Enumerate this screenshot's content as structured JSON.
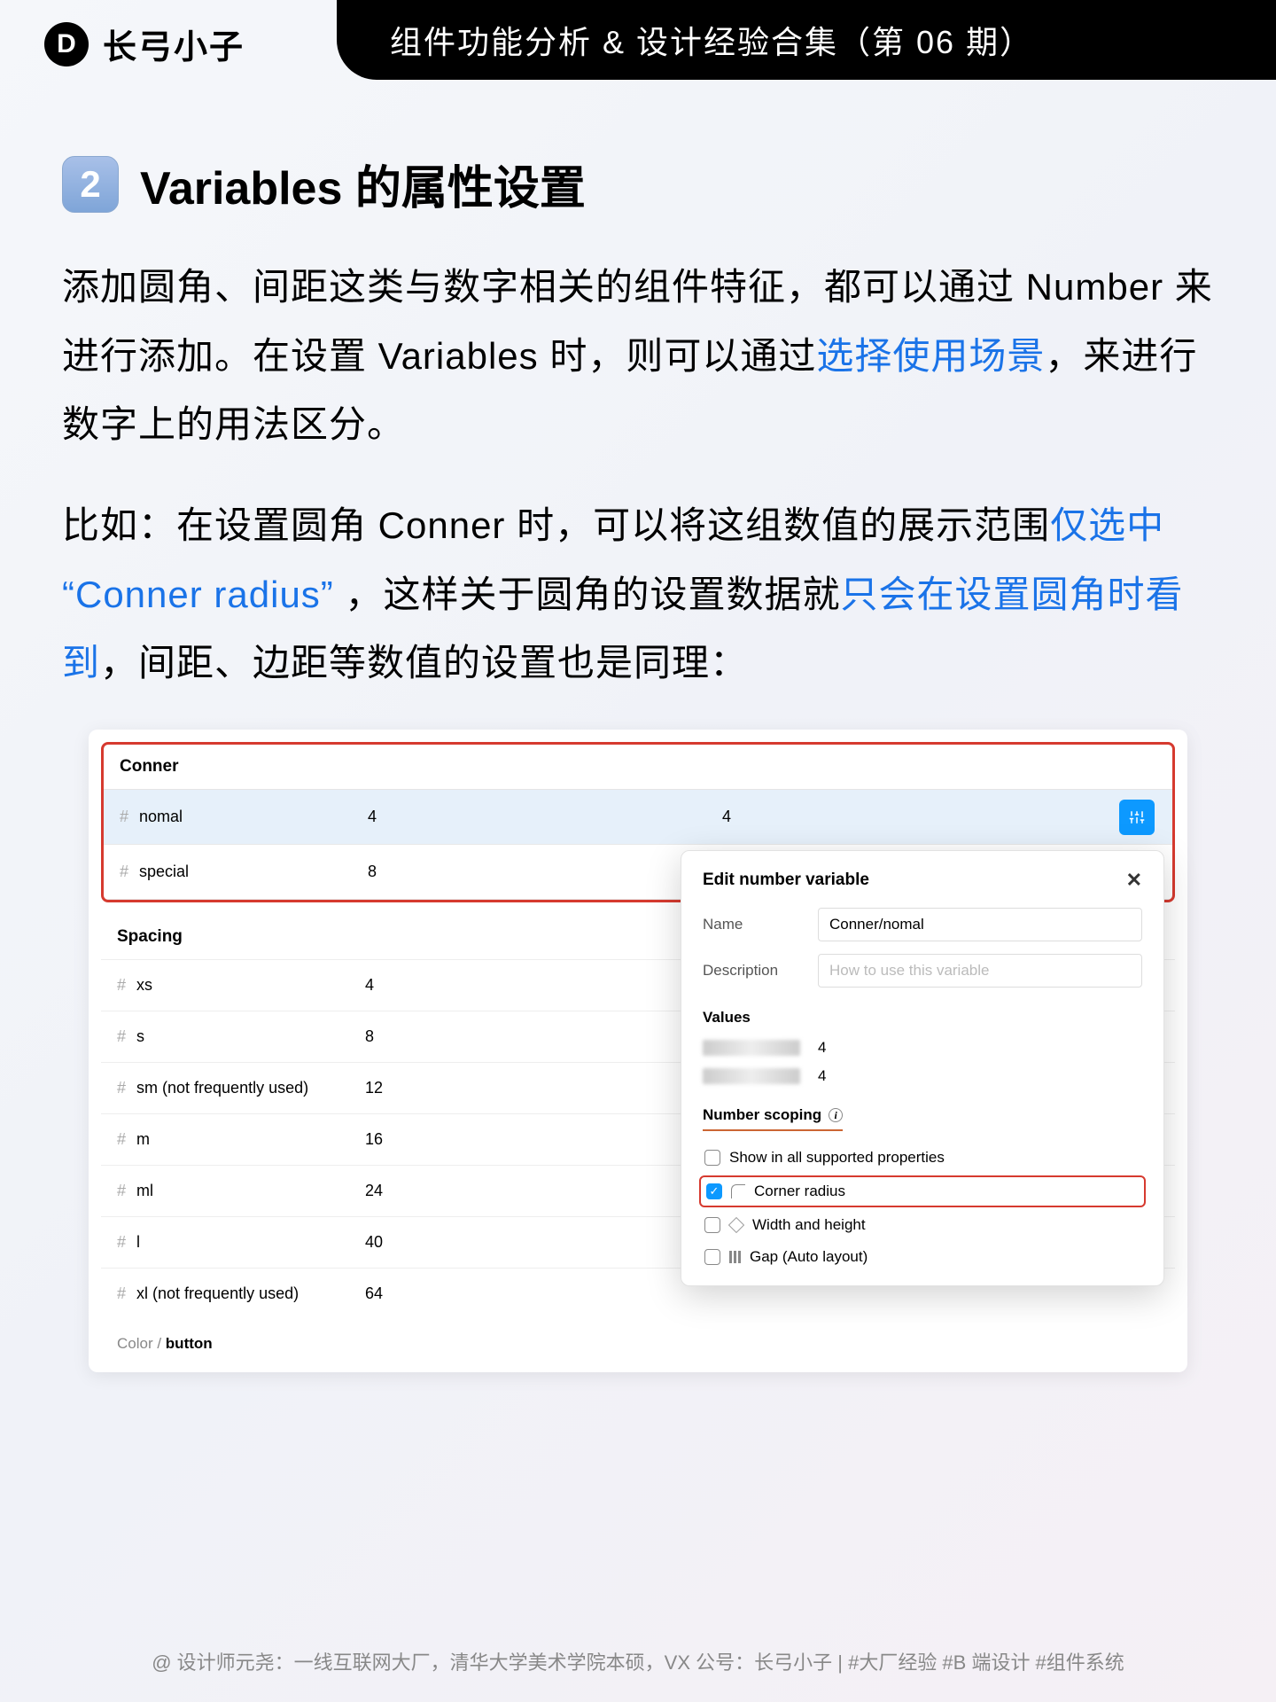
{
  "header": {
    "brand_logo": "D",
    "brand_name": "长弓小子",
    "title": "组件功能分析 & 设计经验合集（第 06 期）"
  },
  "section": {
    "badge": "2",
    "title": "Variables 的属性设置"
  },
  "paragraphs": {
    "p1a": "添加圆角、间距这类与数字相关的组件特征，都可以通过 Number 来进行添加。在设置 Variables 时，则可以通过",
    "p1b": "选择使用场景",
    "p1c": "，来进行数字上的用法区分。",
    "p2a": "比如：在设置圆角 Conner 时，可以将这组数值的展示范围",
    "p2b": "仅选中 “Conner radius” ",
    "p2c": "，这样关于圆角的设置数据就",
    "p2d": "只会在设置圆角时看到",
    "p2e": "，间距、边距等数值的设置也是同理："
  },
  "conner": {
    "label": "Conner",
    "rows": [
      {
        "name": "nomal",
        "v1": "4",
        "v2": "4"
      },
      {
        "name": "special",
        "v1": "8",
        "v2": ""
      }
    ]
  },
  "spacing": {
    "label": "Spacing",
    "rows": [
      {
        "name": "xs",
        "v": "4"
      },
      {
        "name": "s",
        "v": "8"
      },
      {
        "name": "sm (not frequently used)",
        "v": "12"
      },
      {
        "name": "m",
        "v": "16"
      },
      {
        "name": "ml",
        "v": "24"
      },
      {
        "name": "l",
        "v": "40"
      },
      {
        "name": "xl (not frequently used)",
        "v": "64"
      }
    ]
  },
  "footer_group": {
    "prefix": "Color / ",
    "bold": "button"
  },
  "popover": {
    "title": "Edit number variable",
    "name_label": "Name",
    "name_value": "Conner/nomal",
    "desc_label": "Description",
    "desc_ph": "How to use this variable",
    "values_label": "Values",
    "val1": "4",
    "val2": "4",
    "scope_label": "Number scoping",
    "opts": {
      "all": "Show in all supported properties",
      "corner": "Corner radius",
      "wh": "Width and height",
      "gap": "Gap (Auto layout)"
    }
  },
  "page_footer": {
    "author": "@ 设计师元尧：",
    "desc": "一线互联网大厂，清华大学美术学院本硕，VX 公号：长弓小子",
    "sep": " | ",
    "tags": "#大厂经验  #B 端设计  #组件系统"
  }
}
